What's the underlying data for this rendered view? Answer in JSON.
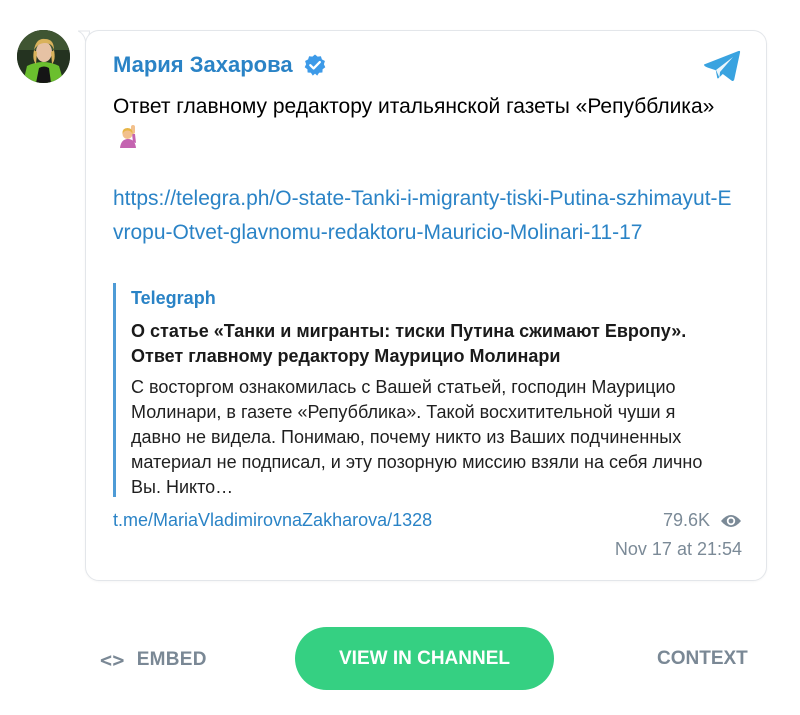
{
  "channel": {
    "author_name": "Мария Захарова",
    "avatar_icon": "avatar-photo",
    "verified_icon": "verified-badge-icon",
    "telegram_icon": "telegram-logo-icon"
  },
  "post": {
    "text": "Ответ главному редактору итальянской газеты «Репубблика»",
    "emoji_icon": "person-raising-hand-emoji",
    "link": "https://telegra.ph/O-state-Tanki-i-migranty-tiski-Putina-szhimayut-Evropu-Otvet-glavnomu-redaktoru-Mauricio-Molinari-11-17",
    "preview": {
      "site": "Telegraph",
      "title": "О статье «Танки и мигранты: тиски Путина сжимают Европу». Ответ главному редактору Маурицио Молинари",
      "description": "С восторгом ознакомилась с Вашей статьей, господин Маурицио Молинари, в газете «Репубблика». Такой восхитительной чуши я давно не видела. Понимаю, почему никто из Ваших подчиненных материал не подписал, и эту позорную миссию взяли на себя лично Вы. Никто…"
    },
    "permalink": "t.me/MariaVladimirovnaZakharova/1328",
    "views": "79.6K",
    "date": "Nov 17 at 21:54"
  },
  "footer": {
    "embed_glyph": "<>",
    "embed_label": "EMBED",
    "view_label": "VIEW IN CHANNEL",
    "context_label": "CONTEXT"
  },
  "colors": {
    "link": "#2a83c6",
    "button": "#35d082",
    "muted": "#7a8895"
  }
}
